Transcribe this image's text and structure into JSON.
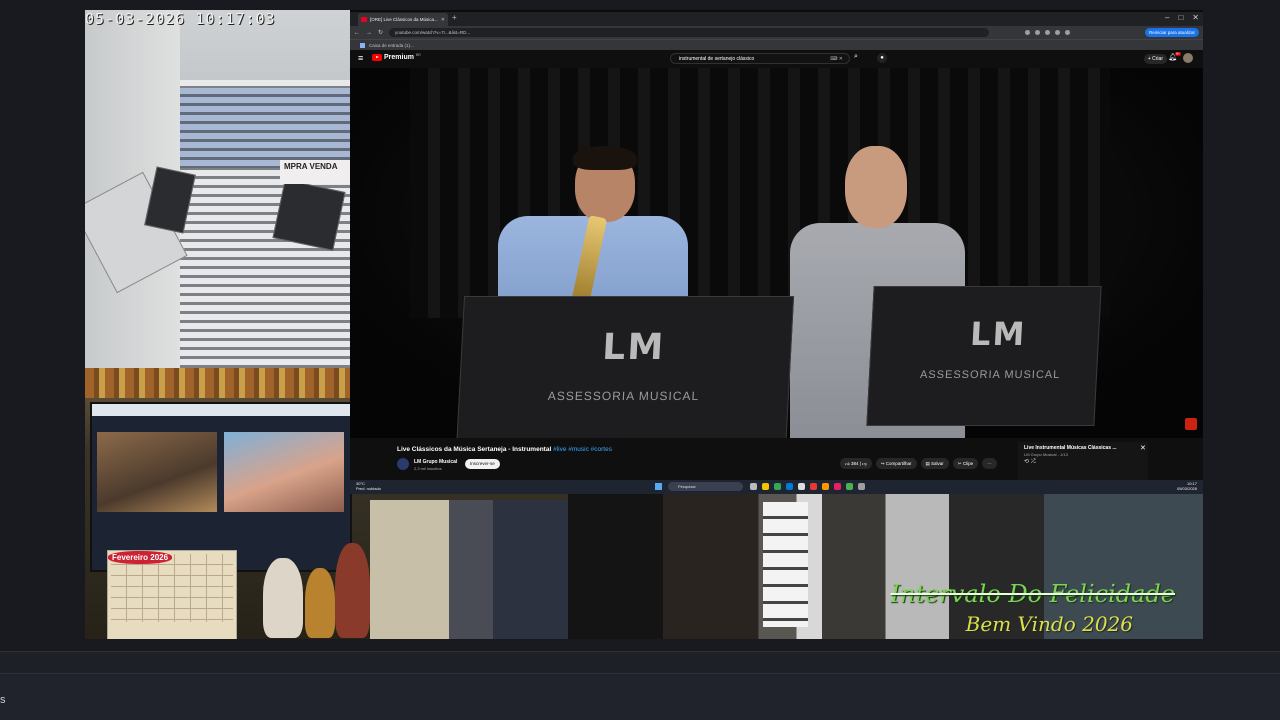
{
  "cctv": {
    "timestamp": "05-03-2026 10:17:03",
    "sign_text": "MPRA VENDA"
  },
  "calendar": {
    "title": "Fevereiro 2026"
  },
  "overlay": {
    "title": "Intervalo Do Felicidade",
    "subtitle": "Bem Vindo 2026"
  },
  "browser": {
    "tab_title": "[ORE] Live Clássicos da Música...",
    "url": "youtube.com/watch?v=7r...&list=RD...",
    "update_button": "Reiniciar para atualizar",
    "bookmark": "Caixa de entrada (1)..."
  },
  "youtube": {
    "brand": "Premium",
    "country": "BR",
    "search_query": "instrumental de sertanejo clássico",
    "create_label": "+ Criar",
    "notification_count": "9+",
    "video": {
      "title": "Live Clássicos da Música Sertaneja - Instrumental",
      "tags": "#live #music #cortes",
      "channel": "LM Grupo Musical",
      "subscribers": "2,3 mil inscritos",
      "subscribe_label": "Inscrever-se",
      "likes": "384",
      "share_label": "Compartilhar",
      "save_label": "Salvar",
      "clip_label": "Clipe"
    },
    "stand_logo": "LM",
    "stand_text": "ASSESSORIA MUSICAL",
    "mini_playlist": {
      "title": "Live Instrumental Músicas Clássicas ...",
      "subtitle": "LM Grupo Musical - 1/13"
    }
  },
  "taskbar": {
    "weather_temp": "30°C",
    "weather_desc": "Pred. nublado",
    "search_placeholder": "Pesquisar",
    "time": "10:17",
    "date": "05/03/2026"
  },
  "bottom": {
    "label": "s"
  },
  "colors": {
    "overlay_green": "#7fd15c",
    "overlay_yellow": "#d8e04a",
    "youtube_red": "#ff0000",
    "link_blue": "#3ea6ff"
  }
}
